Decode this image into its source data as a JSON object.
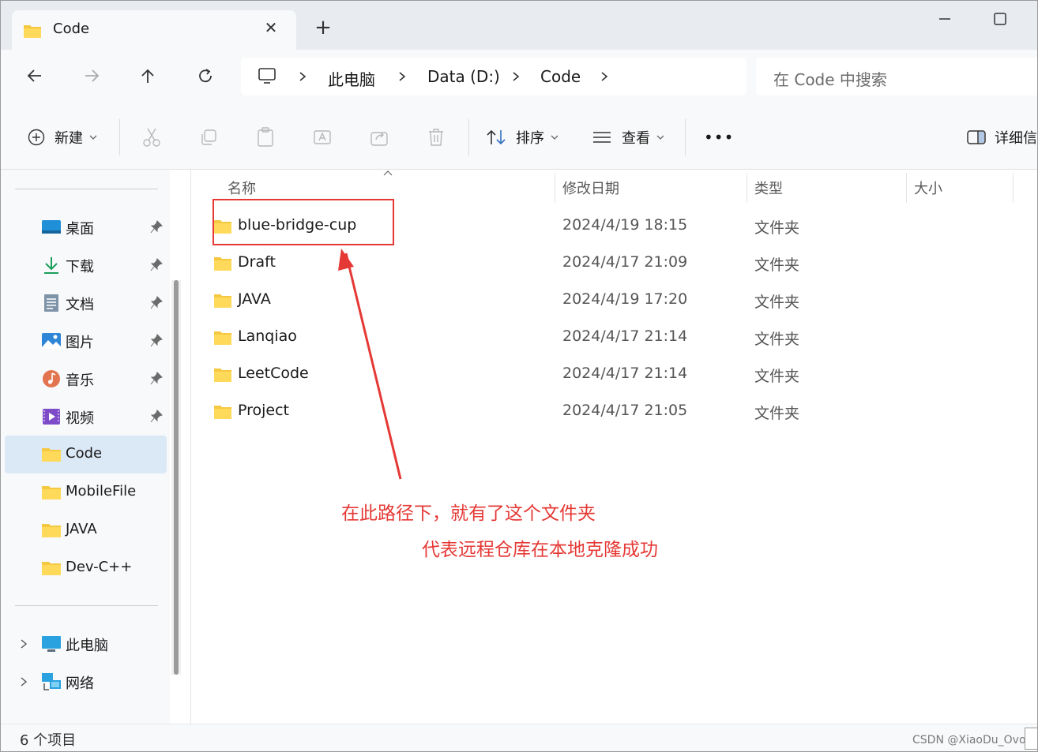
{
  "window": {
    "tab_title": "Code",
    "tab_close_icon": "close-icon",
    "new_tab_icon": "plus-icon"
  },
  "nav": {
    "back_icon": "arrow-left-icon",
    "forward_icon": "arrow-right-icon",
    "up_icon": "arrow-up-icon",
    "refresh_icon": "refresh-icon",
    "breadcrumb": [
      "此电脑",
      "Data (D:)",
      "Code"
    ],
    "search_placeholder": "在 Code 中搜索"
  },
  "toolbar": {
    "new_label": "新建",
    "sort_label": "排序",
    "view_label": "查看",
    "more_label": "•••",
    "details_label": "详细信"
  },
  "sidebar": {
    "pinned": [
      {
        "label": "桌面",
        "icon": "desktop-icon"
      },
      {
        "label": "下载",
        "icon": "download-icon"
      },
      {
        "label": "文档",
        "icon": "document-icon"
      },
      {
        "label": "图片",
        "icon": "picture-icon"
      },
      {
        "label": "音乐",
        "icon": "music-icon"
      },
      {
        "label": "视频",
        "icon": "video-icon"
      }
    ],
    "folders": [
      {
        "label": "Code",
        "active": true
      },
      {
        "label": "MobileFile"
      },
      {
        "label": "JAVA"
      },
      {
        "label": "Dev-C++"
      }
    ],
    "locations": [
      {
        "label": "此电脑",
        "icon": "computer-icon"
      },
      {
        "label": "网络",
        "icon": "network-icon"
      }
    ]
  },
  "columns": {
    "name": "名称",
    "date": "修改日期",
    "type": "类型",
    "size": "大小"
  },
  "files": [
    {
      "name": "blue-bridge-cup",
      "date": "2024/4/19 18:15",
      "type": "文件夹"
    },
    {
      "name": "Draft",
      "date": "2024/4/17 21:09",
      "type": "文件夹"
    },
    {
      "name": "JAVA",
      "date": "2024/4/19 17:20",
      "type": "文件夹"
    },
    {
      "name": "Lanqiao",
      "date": "2024/4/17 21:14",
      "type": "文件夹"
    },
    {
      "name": "LeetCode",
      "date": "2024/4/17 21:14",
      "type": "文件夹"
    },
    {
      "name": "Project",
      "date": "2024/4/17 21:05",
      "type": "文件夹"
    }
  ],
  "annotation": {
    "line1": "在此路径下，就有了这个文件夹",
    "line2": "代表远程仓库在本地克隆成功",
    "color": "#e53935"
  },
  "status": {
    "item_count": "6 个项目",
    "watermark": "CSDN @XiaoDu_Ovo"
  }
}
